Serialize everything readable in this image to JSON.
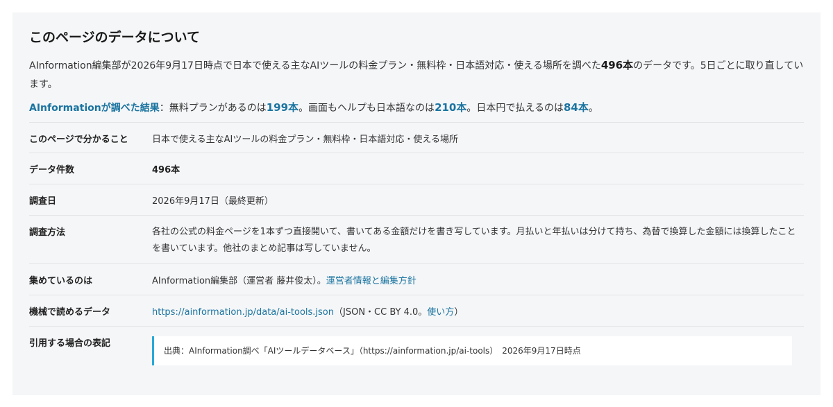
{
  "title": "このページのデータについて",
  "intro": {
    "part1": "AInformation編集部が2026年9月17日時点で日本で使える主なAIツールの料金プラン・無料枠・日本語対応・使える場所を調べた",
    "count": "496本",
    "part2": "のデータです。5日ごとに取り直しています。"
  },
  "result": {
    "lead": "AInformationが調べた結果",
    "t1": "：無料プランがあるのは",
    "v1": "199本",
    "t2": "。画面もヘルプも日本語なのは",
    "v2": "210本",
    "t3": "。日本円で払えるのは",
    "v3": "84本",
    "t4": "。"
  },
  "rows": {
    "scope": {
      "label": "このページで分かること",
      "value": "日本で使える主なAIツールの料金プラン・無料枠・日本語対応・使える場所"
    },
    "count": {
      "label": "データ件数",
      "value": "496本"
    },
    "date": {
      "label": "調査日",
      "value": "2026年9月17日（最終更新）"
    },
    "method": {
      "label": "調査方法",
      "value": "各社の公式の料金ページを1本ずつ直接開いて、書いてある金額だけを書き写しています。月払いと年払いは分けて持ち、為替で換算した金額には換算したことを書いています。他社のまとめ記事は写していません。"
    },
    "collector": {
      "label": "集めているのは",
      "value": "AInformation編集部（運営者 藤井俊太）。",
      "link": "運営者情報と編集方針"
    },
    "machine": {
      "label": "機械で読めるデータ",
      "link": "https://ainformation.jp/data/ai-tools.json",
      "mid": "（JSON・CC BY 4.0。",
      "link2": "使い方",
      "end": "）"
    },
    "citation": {
      "label": "引用する場合の表記",
      "value": "出典：AInformation調べ「AIツールデータベース」（https://ainformation.jp/ai-tools）　2026年9月17日時点"
    }
  }
}
